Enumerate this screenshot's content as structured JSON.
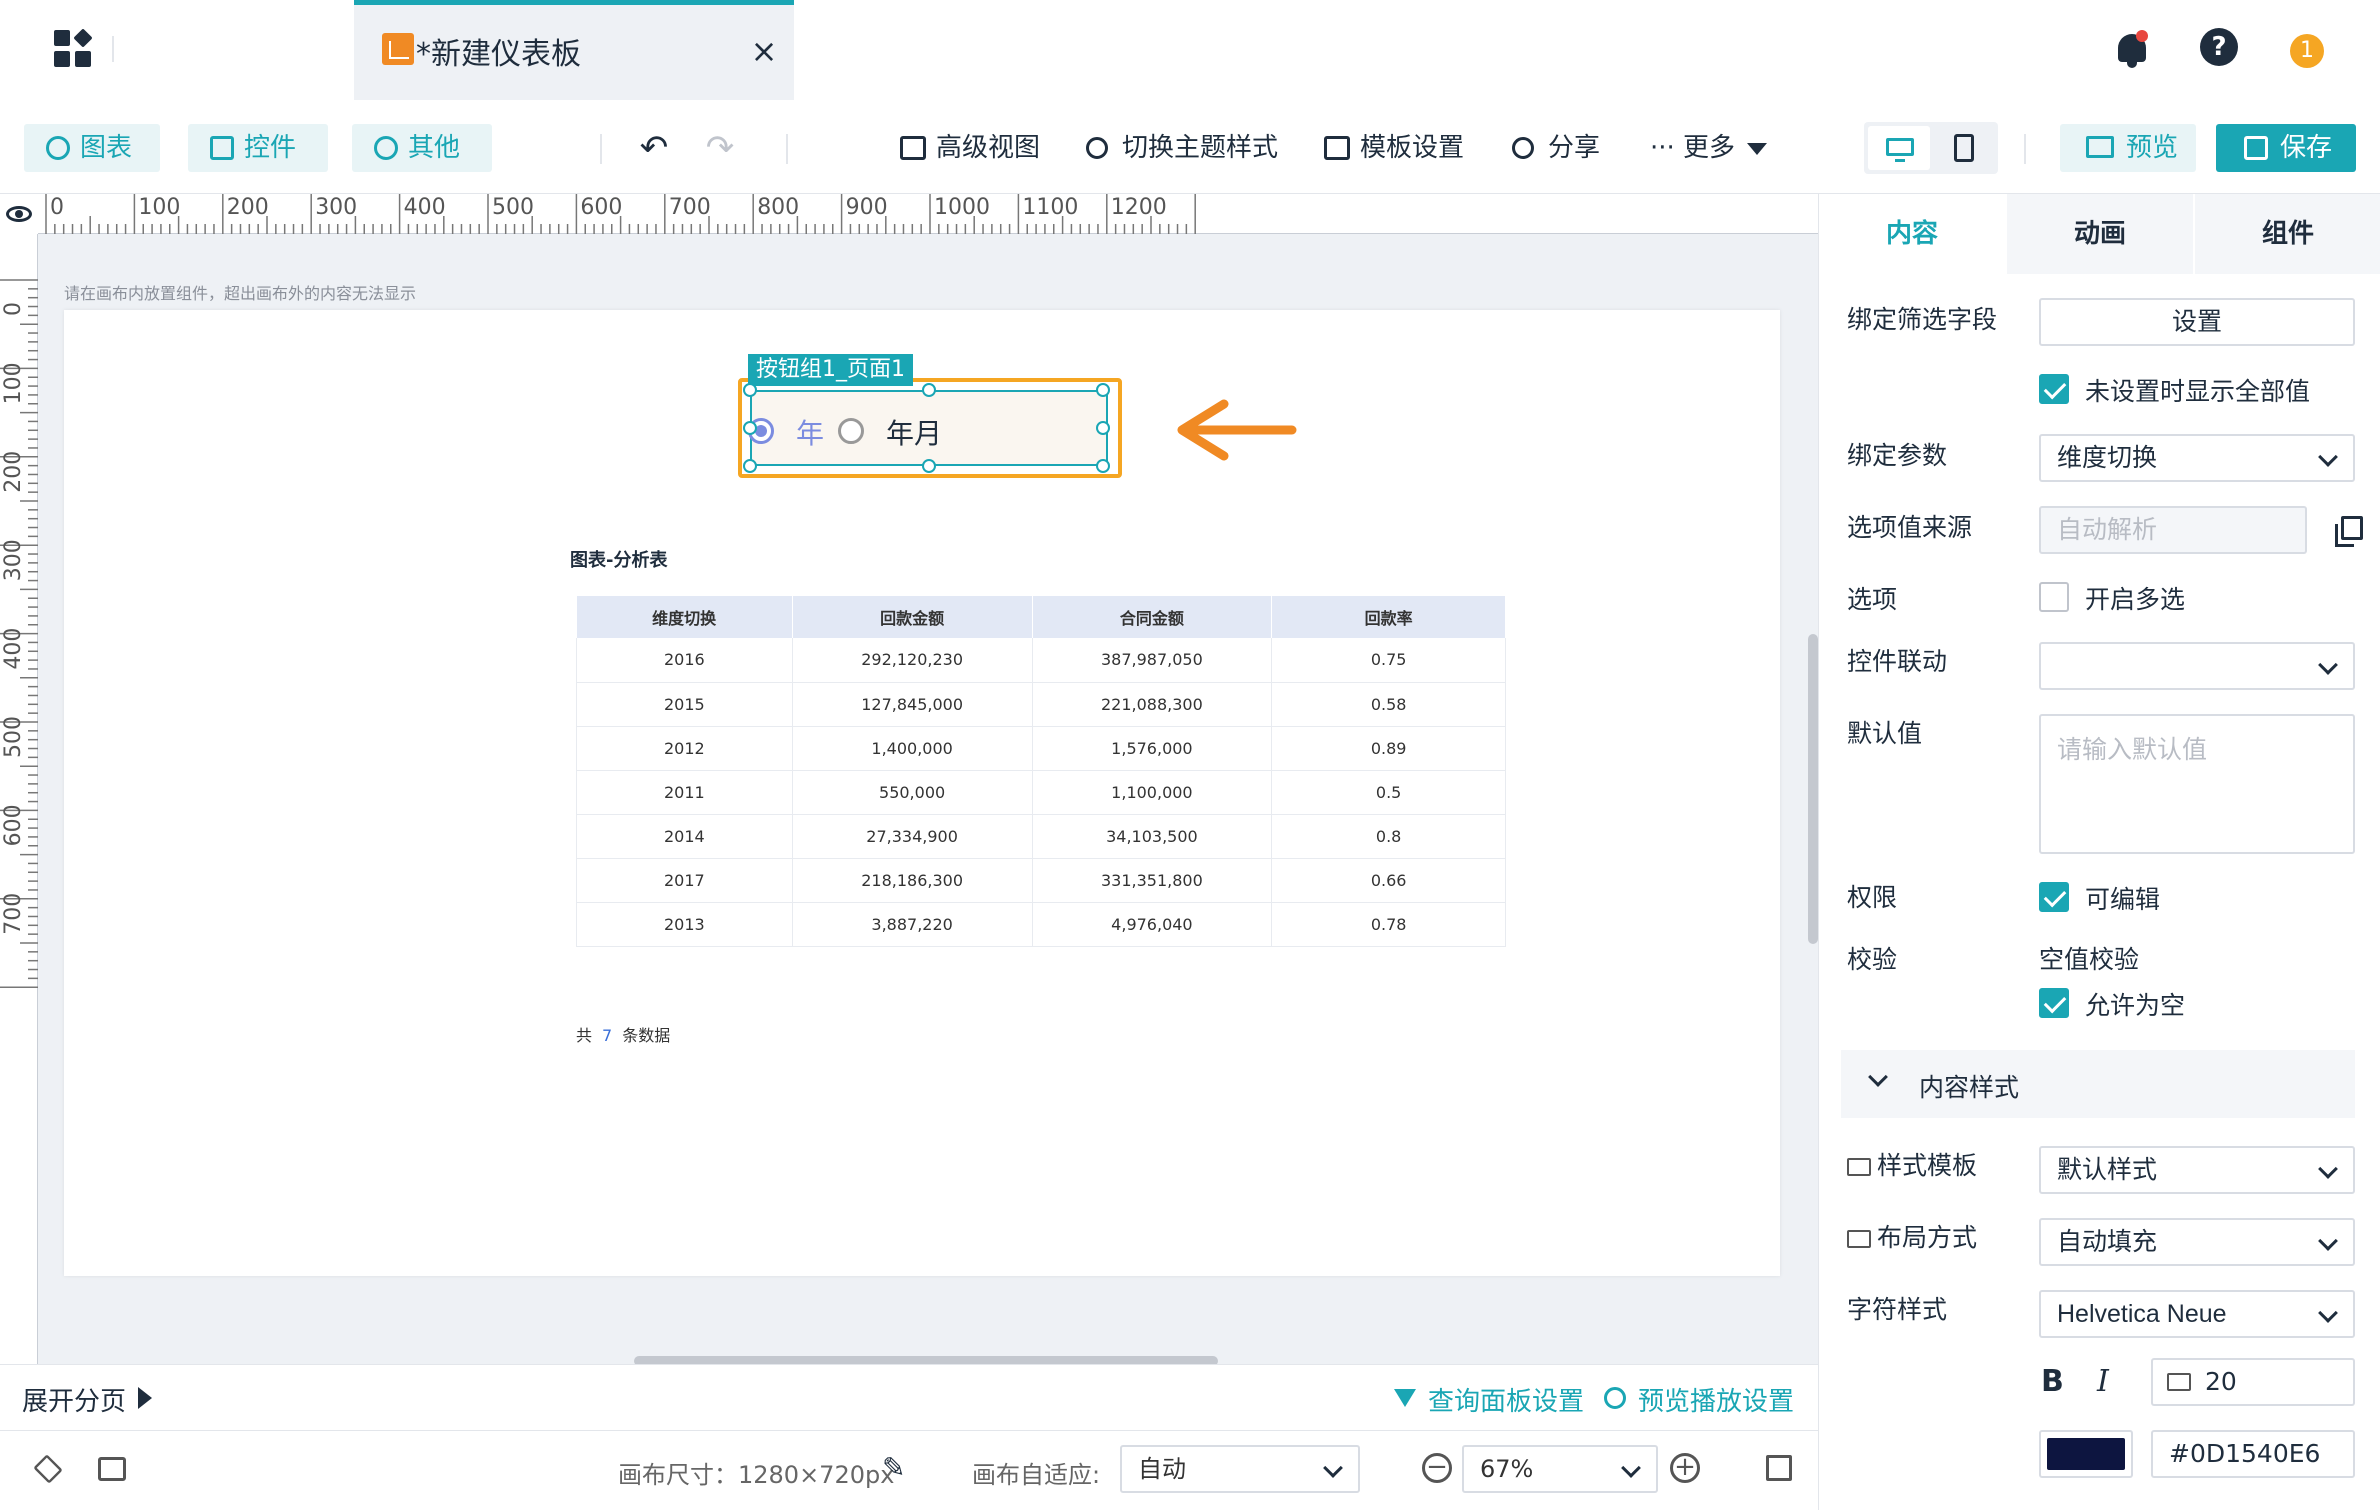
{
  "titlebar": {
    "tab_title": "*新建仪表板",
    "tab_close": "×",
    "help_glyph": "?",
    "user_glyph": "1"
  },
  "toolbar": {
    "chart": "图表",
    "control": "控件",
    "other": "其他",
    "undo": "↶",
    "redo": "↷",
    "advanced_view": "高级视图",
    "switch_theme": "切换主题样式",
    "template_settings": "模板设置",
    "share": "分享",
    "more": "··· 更多",
    "preview": "预览",
    "save": "保存"
  },
  "ruler": {
    "h": [
      "0",
      "100",
      "200",
      "300",
      "400",
      "500",
      "600",
      "700",
      "800",
      "900",
      "1000",
      "1100",
      "1200"
    ],
    "v": [
      "0",
      "100",
      "200",
      "300",
      "400",
      "500",
      "600",
      "700"
    ]
  },
  "canvas": {
    "hint": "请在画布内放置组件，超出画布外的内容无法显示",
    "widget_label": "按钮组1_页面1",
    "radio_year": "年",
    "radio_yearmonth": "年月",
    "table_title": "图表-分析表",
    "columns": [
      "维度切换",
      "回款金额",
      "合同金额",
      "回款率"
    ],
    "rows": [
      [
        "2016",
        "292,120,230",
        "387,987,050",
        "0.75"
      ],
      [
        "2015",
        "127,845,000",
        "221,088,300",
        "0.58"
      ],
      [
        "2012",
        "1,400,000",
        "1,576,000",
        "0.89"
      ],
      [
        "2011",
        "550,000",
        "1,100,000",
        "0.5"
      ],
      [
        "2014",
        "27,334,900",
        "34,103,500",
        "0.8"
      ],
      [
        "2017",
        "218,186,300",
        "331,351,800",
        "0.66"
      ],
      [
        "2013",
        "3,887,220",
        "4,976,040",
        "0.78"
      ]
    ],
    "total_prefix": "共",
    "total_count": "7",
    "total_suffix": "条数据"
  },
  "pager": {
    "expand": "展开分页",
    "query_settings": "查询面板设置",
    "preview_settings": "预览播放设置"
  },
  "status": {
    "canvas_size_label": "画布尺寸：1280×720px",
    "adapt_label": "画布自适应:",
    "adapt_value": "自动",
    "zoom_value": "67%",
    "zoom_out": "−",
    "zoom_in": "+"
  },
  "rpanel": {
    "tabs": [
      "内容",
      "动画",
      "组件"
    ],
    "bind_filter_label": "绑定筛选字段",
    "bind_filter_btn": "设置",
    "show_all_label": "未设置时显示全部值",
    "bind_param_label": "绑定参数",
    "bind_param_value": "维度切换",
    "option_source_label": "选项值来源",
    "option_source_value": "自动解析",
    "option_label": "选项",
    "multi_label": "开启多选",
    "linkage_label": "控件联动",
    "default_label": "默认值",
    "default_placeholder": "请输入默认值",
    "permission_label": "权限",
    "editable_label": "可编辑",
    "validate_label": "校验",
    "empty_check_label": "空值校验",
    "allow_empty_label": "允许为空",
    "content_style_label": "内容样式",
    "style_template_label": "样式模板",
    "style_template_value": "默认样式",
    "layout_label": "布局方式",
    "layout_value": "自动填充",
    "font_style_label": "字符样式",
    "font_value": "Helvetica Neue",
    "bold": "B",
    "italic": "I",
    "font_size": "20",
    "color_hex": "#0D1540E6"
  },
  "colors": {
    "accent": "#1aa6b4",
    "highlight": "#f5a623",
    "text_color": "#0D1540"
  }
}
